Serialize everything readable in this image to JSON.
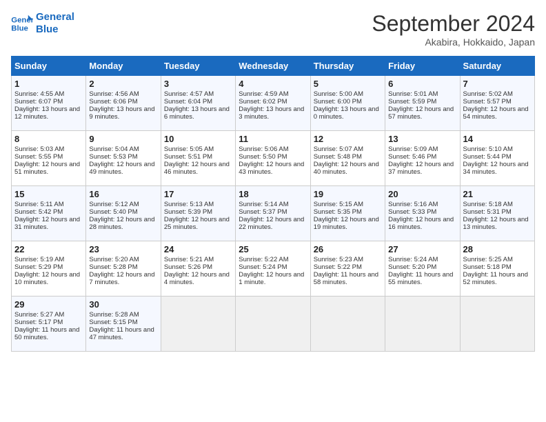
{
  "header": {
    "logo": {
      "line1": "General",
      "line2": "Blue"
    },
    "title": "September 2024",
    "subtitle": "Akabira, Hokkaido, Japan"
  },
  "days_of_week": [
    "Sunday",
    "Monday",
    "Tuesday",
    "Wednesday",
    "Thursday",
    "Friday",
    "Saturday"
  ],
  "weeks": [
    [
      {
        "day": "1",
        "sunrise": "Sunrise: 4:55 AM",
        "sunset": "Sunset: 6:07 PM",
        "daylight": "Daylight: 13 hours and 12 minutes."
      },
      {
        "day": "2",
        "sunrise": "Sunrise: 4:56 AM",
        "sunset": "Sunset: 6:06 PM",
        "daylight": "Daylight: 13 hours and 9 minutes."
      },
      {
        "day": "3",
        "sunrise": "Sunrise: 4:57 AM",
        "sunset": "Sunset: 6:04 PM",
        "daylight": "Daylight: 13 hours and 6 minutes."
      },
      {
        "day": "4",
        "sunrise": "Sunrise: 4:59 AM",
        "sunset": "Sunset: 6:02 PM",
        "daylight": "Daylight: 13 hours and 3 minutes."
      },
      {
        "day": "5",
        "sunrise": "Sunrise: 5:00 AM",
        "sunset": "Sunset: 6:00 PM",
        "daylight": "Daylight: 13 hours and 0 minutes."
      },
      {
        "day": "6",
        "sunrise": "Sunrise: 5:01 AM",
        "sunset": "Sunset: 5:59 PM",
        "daylight": "Daylight: 12 hours and 57 minutes."
      },
      {
        "day": "7",
        "sunrise": "Sunrise: 5:02 AM",
        "sunset": "Sunset: 5:57 PM",
        "daylight": "Daylight: 12 hours and 54 minutes."
      }
    ],
    [
      {
        "day": "8",
        "sunrise": "Sunrise: 5:03 AM",
        "sunset": "Sunset: 5:55 PM",
        "daylight": "Daylight: 12 hours and 51 minutes."
      },
      {
        "day": "9",
        "sunrise": "Sunrise: 5:04 AM",
        "sunset": "Sunset: 5:53 PM",
        "daylight": "Daylight: 12 hours and 49 minutes."
      },
      {
        "day": "10",
        "sunrise": "Sunrise: 5:05 AM",
        "sunset": "Sunset: 5:51 PM",
        "daylight": "Daylight: 12 hours and 46 minutes."
      },
      {
        "day": "11",
        "sunrise": "Sunrise: 5:06 AM",
        "sunset": "Sunset: 5:50 PM",
        "daylight": "Daylight: 12 hours and 43 minutes."
      },
      {
        "day": "12",
        "sunrise": "Sunrise: 5:07 AM",
        "sunset": "Sunset: 5:48 PM",
        "daylight": "Daylight: 12 hours and 40 minutes."
      },
      {
        "day": "13",
        "sunrise": "Sunrise: 5:09 AM",
        "sunset": "Sunset: 5:46 PM",
        "daylight": "Daylight: 12 hours and 37 minutes."
      },
      {
        "day": "14",
        "sunrise": "Sunrise: 5:10 AM",
        "sunset": "Sunset: 5:44 PM",
        "daylight": "Daylight: 12 hours and 34 minutes."
      }
    ],
    [
      {
        "day": "15",
        "sunrise": "Sunrise: 5:11 AM",
        "sunset": "Sunset: 5:42 PM",
        "daylight": "Daylight: 12 hours and 31 minutes."
      },
      {
        "day": "16",
        "sunrise": "Sunrise: 5:12 AM",
        "sunset": "Sunset: 5:40 PM",
        "daylight": "Daylight: 12 hours and 28 minutes."
      },
      {
        "day": "17",
        "sunrise": "Sunrise: 5:13 AM",
        "sunset": "Sunset: 5:39 PM",
        "daylight": "Daylight: 12 hours and 25 minutes."
      },
      {
        "day": "18",
        "sunrise": "Sunrise: 5:14 AM",
        "sunset": "Sunset: 5:37 PM",
        "daylight": "Daylight: 12 hours and 22 minutes."
      },
      {
        "day": "19",
        "sunrise": "Sunrise: 5:15 AM",
        "sunset": "Sunset: 5:35 PM",
        "daylight": "Daylight: 12 hours and 19 minutes."
      },
      {
        "day": "20",
        "sunrise": "Sunrise: 5:16 AM",
        "sunset": "Sunset: 5:33 PM",
        "daylight": "Daylight: 12 hours and 16 minutes."
      },
      {
        "day": "21",
        "sunrise": "Sunrise: 5:18 AM",
        "sunset": "Sunset: 5:31 PM",
        "daylight": "Daylight: 12 hours and 13 minutes."
      }
    ],
    [
      {
        "day": "22",
        "sunrise": "Sunrise: 5:19 AM",
        "sunset": "Sunset: 5:29 PM",
        "daylight": "Daylight: 12 hours and 10 minutes."
      },
      {
        "day": "23",
        "sunrise": "Sunrise: 5:20 AM",
        "sunset": "Sunset: 5:28 PM",
        "daylight": "Daylight: 12 hours and 7 minutes."
      },
      {
        "day": "24",
        "sunrise": "Sunrise: 5:21 AM",
        "sunset": "Sunset: 5:26 PM",
        "daylight": "Daylight: 12 hours and 4 minutes."
      },
      {
        "day": "25",
        "sunrise": "Sunrise: 5:22 AM",
        "sunset": "Sunset: 5:24 PM",
        "daylight": "Daylight: 12 hours and 1 minute."
      },
      {
        "day": "26",
        "sunrise": "Sunrise: 5:23 AM",
        "sunset": "Sunset: 5:22 PM",
        "daylight": "Daylight: 11 hours and 58 minutes."
      },
      {
        "day": "27",
        "sunrise": "Sunrise: 5:24 AM",
        "sunset": "Sunset: 5:20 PM",
        "daylight": "Daylight: 11 hours and 55 minutes."
      },
      {
        "day": "28",
        "sunrise": "Sunrise: 5:25 AM",
        "sunset": "Sunset: 5:18 PM",
        "daylight": "Daylight: 11 hours and 52 minutes."
      }
    ],
    [
      {
        "day": "29",
        "sunrise": "Sunrise: 5:27 AM",
        "sunset": "Sunset: 5:17 PM",
        "daylight": "Daylight: 11 hours and 50 minutes."
      },
      {
        "day": "30",
        "sunrise": "Sunrise: 5:28 AM",
        "sunset": "Sunset: 5:15 PM",
        "daylight": "Daylight: 11 hours and 47 minutes."
      },
      null,
      null,
      null,
      null,
      null
    ]
  ]
}
